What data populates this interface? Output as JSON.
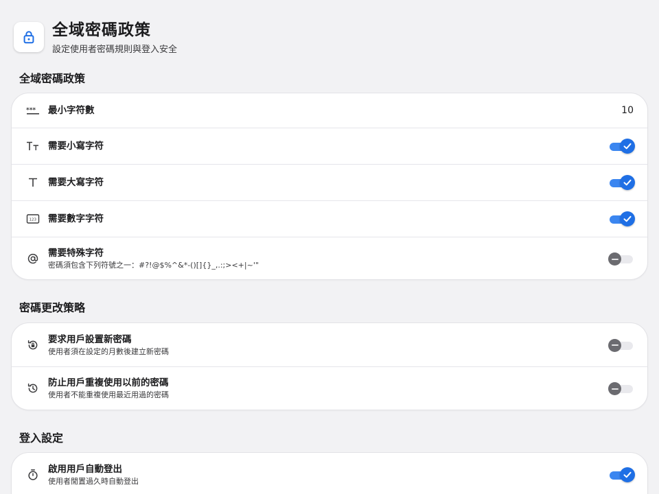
{
  "header": {
    "title": "全域密碼政策",
    "subtitle": "設定使用者密碼規則與登入安全"
  },
  "sections": [
    {
      "title": "全域密碼政策",
      "rows": [
        {
          "label": "最小字符數",
          "value": "10",
          "icon": "password-dots-icon"
        },
        {
          "label": "需要小寫字符",
          "toggle": true,
          "icon": "text-size-icon"
        },
        {
          "label": "需要大寫字符",
          "toggle": true,
          "icon": "text-t-icon"
        },
        {
          "label": "需要數字字符",
          "toggle": true,
          "icon": "number-123-icon"
        },
        {
          "label": "需要特殊字符",
          "desc": "密碼須包含下列符號之一：#?!@$%^&*-()[]{}_,.:;><+|~'\"",
          "toggle": false,
          "icon": "at-sign-icon"
        }
      ]
    },
    {
      "title": "密碼更改策略",
      "rows": [
        {
          "label": "要求用戶設置新密碼",
          "desc": "使用者須在設定的月數後建立新密碼",
          "toggle": false,
          "icon": "lock-rotate-icon"
        },
        {
          "label": "防止用戶重複使用以前的密碼",
          "desc": "使用者不能重複使用最近用過的密碼",
          "toggle": false,
          "icon": "history-icon"
        }
      ]
    },
    {
      "title": "登入設定",
      "rows": [
        {
          "label": "啟用用戶自動登出",
          "desc": "使用者閒置過久時自動登出",
          "toggle": true,
          "icon": "timer-icon"
        }
      ]
    }
  ],
  "colors": {
    "accent": "#1f6fe5",
    "track_on": "#3b86f0",
    "knob_off": "#6b6b70"
  }
}
